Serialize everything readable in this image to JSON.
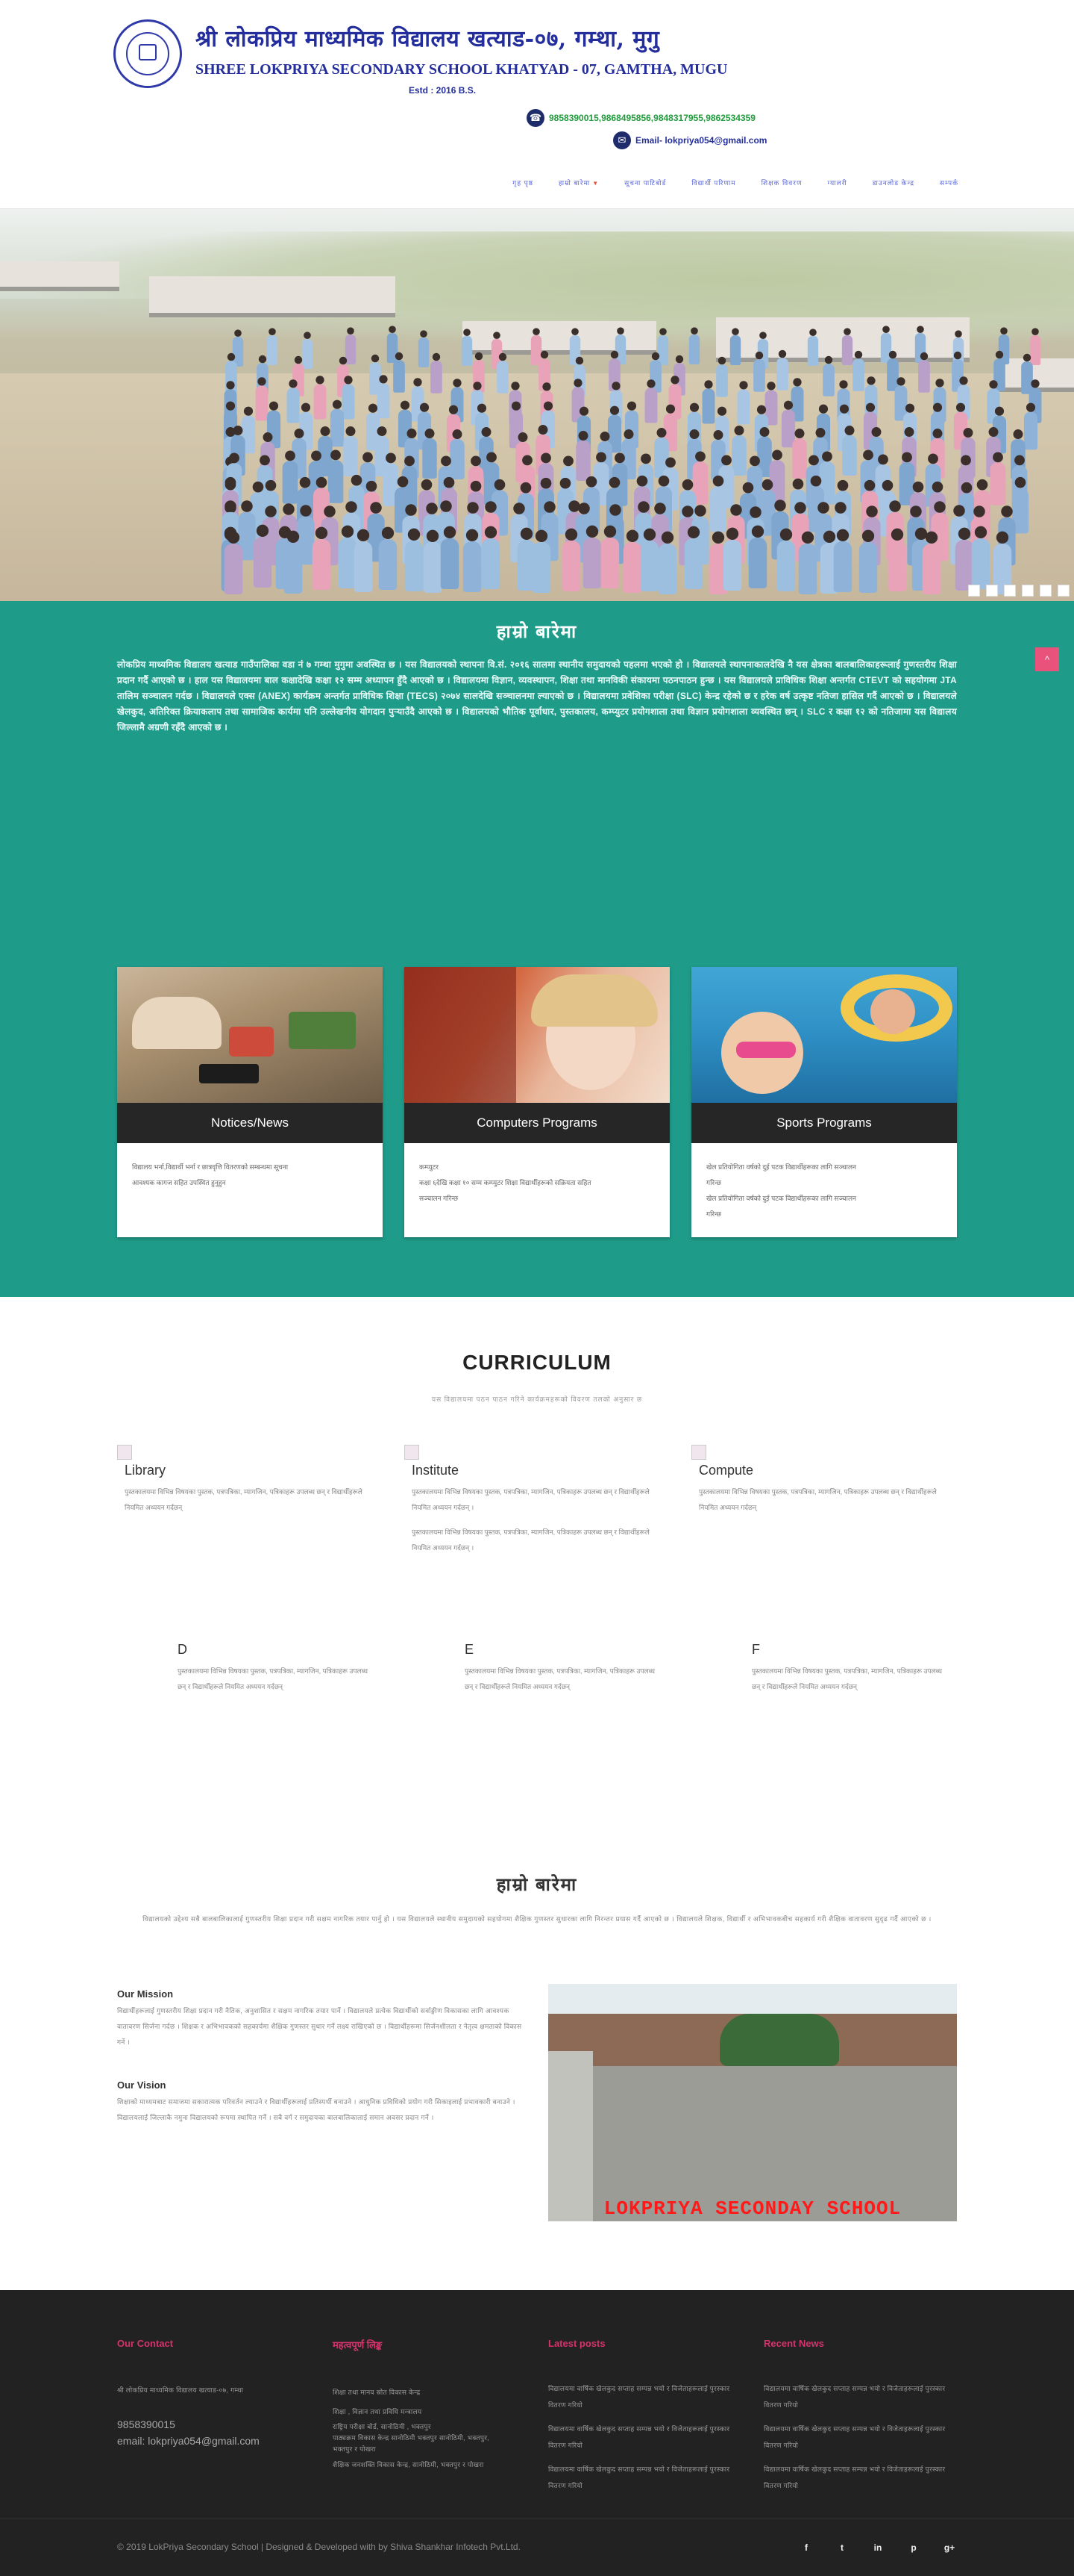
{
  "header": {
    "title_np": "श्री लोकप्रिय माध्यमिक विद्यालय खत्याड-०७, गम्था, मुगु",
    "title_en": "SHREE LOKPRIYA SECONDARY SCHOOL KHATYAD - 07, GAMTHA, MUGU",
    "estd": "Estd : 2016 B.S.",
    "phones": "9858390015,9868495856,9848317955,9862534359",
    "email": "Email- lokpriya054@gmail.com"
  },
  "nav": {
    "items": [
      "गृह पृष्ठ",
      "हाम्रो बारेमा",
      "सूचना पाटिबोर्ड",
      "विद्यार्थी परिणाम",
      "शिक्षक विवरण",
      "ग्यालरी",
      "डाउनलोड केन्द्र",
      "सम्पर्क"
    ]
  },
  "hero": {
    "slides": 6
  },
  "about": {
    "title": "हाम्रो बारेमा",
    "text": "लोकप्रिय माध्यमिक विद्यालय खत्याड गाउँपालिका वडा नं ७ गम्था मुगुमा अवस्थित छ । यस विद्यालयको स्थापना वि.सं. २०१६ सालमा स्थानीय समुदायको पहलमा भएको हो । विद्यालयले स्थापनाकालदेखि नै यस क्षेत्रका बालबालिकाहरूलाई गुणस्तरीय शिक्षा प्रदान गर्दै आएको छ । हाल यस विद्यालयमा बाल कक्षादेखि कक्षा १२ सम्म अध्यापन हुँदै आएको छ । विद्यालयमा विज्ञान, व्यवस्थापन, शिक्षा तथा मानविकी संकायमा पठनपाठन हुन्छ । यस विद्यालयले प्राविधिक शिक्षा अन्तर्गत CTEVT को सहयोगमा JTA तालिम सञ्चालन गर्दछ । विद्यालयले एक्स (ANEX) कार्यक्रम अन्तर्गत प्राविधिक शिक्षा (TECS) २०७४ सालदेखि सञ्चालनमा ल्याएको छ । विद्यालयमा प्रवेशिका परीक्षा (SLC) केन्द्र रहेको छ र हरेक वर्ष उत्कृष्ट नतिजा हासिल गर्दै आएको छ । विद्यालयले खेलकुद, अतिरिक्त क्रियाकलाप तथा सामाजिक कार्यमा पनि उल्लेखनीय योगदान पुर्‍याउँदै आएको छ । विद्यालयको भौतिक पूर्वाधार, पुस्तकालय, कम्प्युटर प्रयोगशाला तथा विज्ञान प्रयोगशाला व्यवस्थित छन् । SLC र कक्षा १२ को नतिजामा यस विद्यालय जिल्लामै अग्रणी रहँदै आएको छ ।",
    "scroll_top": "^"
  },
  "cards": [
    {
      "title": "Notices/News",
      "lines": [
        "विद्यालय भर्ना,विद्यार्थी भर्ना र छात्रवृत्ति वितरणको सम्बन्धमा सूचना",
        "आवश्यक कागज सहित उपस्थित हुनुहुन"
      ]
    },
    {
      "title": "Computers Programs",
      "lines": [
        "कम्प्युटर",
        "कक्षा ६देखि कक्षा १० सम्म कम्प्युटर शिक्षा विद्यार्थीहरूको सक्रियता सहित",
        "सञ्चालन गरिन्छ"
      ]
    },
    {
      "title": "Sports Programs",
      "lines": [
        "खेल प्रतियोगिता वर्षको दुई पटक विद्यार्थीहरूका लागि सञ्चालन",
        "गरिन्छ",
        "खेल प्रतियोगिता वर्षको दुई पटक विद्यार्थीहरूका लागि सञ्चालन",
        "गरिन्छ"
      ]
    }
  ],
  "curriculum": {
    "title": "CURRICULUM",
    "subtitle": "यस विद्यालयमा पठन पाठन गरिने कार्यक्रमहरूको विवरण तलको अनुसार छ",
    "items": [
      {
        "head": "Library",
        "text": "पुस्तकालयमा विभिन्न विषयका पुस्तक, पत्रपत्रिका, म्यागजिन, पत्रिकाहरू उपलब्ध छन् र विद्यार्थीहरूले नियमित अध्ययन गर्दछन्"
      },
      {
        "head": "Institute",
        "text": "पुस्तकालयमा विभिन्न विषयका पुस्तक, पत्रपत्रिका, म्यागजिन, पत्रिकाहरू उपलब्ध छन् र विद्यार्थीहरूले नियमित अध्ययन गर्दछन् ।",
        "text2": "पुस्तकालयमा विभिन्न विषयका पुस्तक, पत्रपत्रिका, म्यागजिन, पत्रिकाहरू उपलब्ध छन् र विद्यार्थीहरूले नियमित अध्ययन गर्दछन् ।"
      },
      {
        "head": "Compute",
        "text": "पुस्तकालयमा विभिन्न विषयका पुस्तक, पत्रपत्रिका, म्यागजिन, पत्रिकाहरू उपलब्ध छन् र विद्यार्थीहरूले नियमित अध्ययन गर्दछन्"
      },
      {
        "head": "D",
        "text": "पुस्तकालयमा विभिन्न विषयका पुस्तक, पत्रपत्रिका, म्यागजिन, पत्रिकाहरू उपलब्ध छन् र विद्यार्थीहरूले नियमित अध्ययन गर्दछन्"
      },
      {
        "head": "E",
        "text": "पुस्तकालयमा विभिन्न विषयका पुस्तक, पत्रपत्रिका, म्यागजिन, पत्रिकाहरू उपलब्ध छन् र विद्यार्थीहरूले नियमित अध्ययन गर्दछन्"
      },
      {
        "head": "F",
        "text": "पुस्तकालयमा विभिन्न विषयका पुस्तक, पत्रपत्रिका, म्यागजिन, पत्रिकाहरू उपलब्ध छन् र विद्यार्थीहरूले नियमित अध्ययन गर्दछन्"
      }
    ]
  },
  "about2": {
    "title": "हाम्रो बारेमा",
    "intro": "विद्यालयको उद्देश्य सबै बालबालिकालाई गुणस्तरीय शिक्षा प्रदान गरी सक्षम नागरिक तयार पार्नु हो । यस विद्यालयले स्थानीय समुदायको सहयोगमा शैक्षिक गुणस्तर सुधारका लागि निरन्तर प्रयास गर्दै आएको छ । विद्यालयले शिक्षक, विद्यार्थी र अभिभावकबीच सहकार्य गरी शैक्षिक वातावरण सुदृढ गर्दै आएको छ ।",
    "mission_head": "Our Mission",
    "mission_text": "विद्यार्थीहरूलाई गुणस्तरीय शिक्षा प्रदान गरी नैतिक, अनुशासित र सक्षम नागरिक तयार पार्ने । विद्यालयले प्रत्येक विद्यार्थीको सर्वाङ्गीण विकासका लागि आवश्यक वातावरण सिर्जना गर्दछ । शिक्षक र अभिभावकको सहकार्यमा शैक्षिक गुणस्तर सुधार गर्ने लक्ष्य राखिएको छ । विद्यार्थीहरूमा सिर्जनशीलता र नेतृत्व क्षमताको विकास गर्ने ।",
    "vision_head": "Our Vision",
    "vision_text": "शिक्षाको माध्यमबाट समाजमा सकारात्मक परिवर्तन ल्याउने र विद्यार्थीहरूलाई प्रतिस्पर्धी बनाउने । आधुनिक प्रविधिको प्रयोग गरी सिकाइलाई प्रभावकारी बनाउने । विद्यालयलाई जिल्लाकै नमुना विद्यालयको रूपमा स्थापित गर्ने । सबै वर्ग र समुदायका बालबालिकालाई समान अवसर प्रदान गर्ने ।",
    "caption": "LOKPRIYA SECONDAY SCHOOL"
  },
  "footer": {
    "contact_head": "Our Contact",
    "contact_addr": "श्री लोकप्रिय माध्यमिक विद्यालय खत्याड-०७, गम्था",
    "contact_phone": "9858390015",
    "contact_email": "email: lokpriya054@gmail.com",
    "links_head": "महत्वपूर्ण लिङ्क",
    "links": [
      "शिक्षा तथा मानव स्रोत विकास केन्द्र",
      "शिक्षा , विज्ञान तथा प्रविधि मन्त्रालय",
      "राष्ट्रिय परीक्षा बोर्ड, सानोठिमी , भक्तपुर",
      "पाठ्यक्रम विकास केन्द्र सानोठिमी भक्तपुर सानोठिमी, भक्तपुर,",
      "भक्तपुर र पोखरा",
      "शैक्षिक जनशक्ति विकास केन्द्र, सानोठिमी, भक्तपुर र पोखरा"
    ],
    "posts_head": "Latest posts",
    "posts": [
      "विद्यालयमा वार्षिक खेलकुद सप्ताह सम्पन्न भयो र विजेताहरूलाई पुरस्कार वितरण गरियो",
      "विद्यालयमा वार्षिक खेलकुद सप्ताह सम्पन्न भयो र विजेताहरूलाई पुरस्कार वितरण गरियो",
      "विद्यालयमा वार्षिक खेलकुद सप्ताह सम्पन्न भयो र विजेताहरूलाई पुरस्कार वितरण गरियो"
    ],
    "news_head": "Recent News",
    "news": [
      "विद्यालयमा वार्षिक खेलकुद सप्ताह सम्पन्न भयो र विजेताहरूलाई पुरस्कार वितरण गरियो",
      "विद्यालयमा वार्षिक खेलकुद सप्ताह सम्पन्न भयो र विजेताहरूलाई पुरस्कार वितरण गरियो",
      "विद्यालयमा वार्षिक खेलकुद सप्ताह सम्पन्न भयो र विजेताहरूलाई पुरस्कार वितरण गरियो"
    ],
    "copyright": "© 2019 LokPriya Secondary School | Designed & Developed with by Shiva Shankhar Infotech Pvt.Ltd.",
    "social": [
      "facebook-icon",
      "twitter-icon",
      "linkedin-icon",
      "pinterest-icon",
      "google-plus-icon"
    ],
    "social_glyphs": [
      "f",
      "t",
      "in",
      "p",
      "g+"
    ]
  },
  "colors": {
    "teal": "#1f9b8a",
    "brand_blue": "#232e9c",
    "pink": "#d6336c",
    "footer_bg": "#222222"
  }
}
